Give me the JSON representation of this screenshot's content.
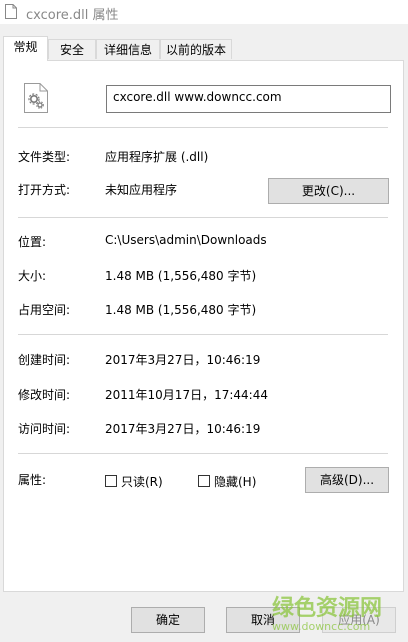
{
  "window": {
    "title": "cxcore.dll 属性"
  },
  "tabs": [
    {
      "label": "常规"
    },
    {
      "label": "安全"
    },
    {
      "label": "详细信息"
    },
    {
      "label": "以前的版本"
    }
  ],
  "file_name": "cxcore.dll     www.downcc.com",
  "rows": {
    "type": {
      "label": "文件类型:",
      "value": "应用程序扩展 (.dll)"
    },
    "open_with": {
      "label": "打开方式:",
      "value": "未知应用程序",
      "button": "更改(C)..."
    },
    "location": {
      "label": "位置:",
      "value": "C:\\Users\\admin\\Downloads"
    },
    "size": {
      "label": "大小:",
      "value": "1.48 MB (1,556,480 字节)"
    },
    "size_on_disk": {
      "label": "占用空间:",
      "value": "1.48 MB (1,556,480 字节)"
    },
    "created": {
      "label": "创建时间:",
      "value": "2017年3月27日，10:46:19"
    },
    "modified": {
      "label": "修改时间:",
      "value": "2011年10月17日，17:44:44"
    },
    "accessed": {
      "label": "访问时间:",
      "value": "2017年3月27日，10:46:19"
    },
    "attributes": {
      "label": "属性:",
      "readonly": "只读(R)",
      "hidden": "隐藏(H)",
      "advanced": "高级(D)..."
    }
  },
  "footer": {
    "ok": "确定",
    "cancel": "取消",
    "apply": "应用(A)"
  },
  "watermark": {
    "text": "绿色资源网",
    "url": "www.downcc.com",
    "color": "#8cc63f"
  }
}
